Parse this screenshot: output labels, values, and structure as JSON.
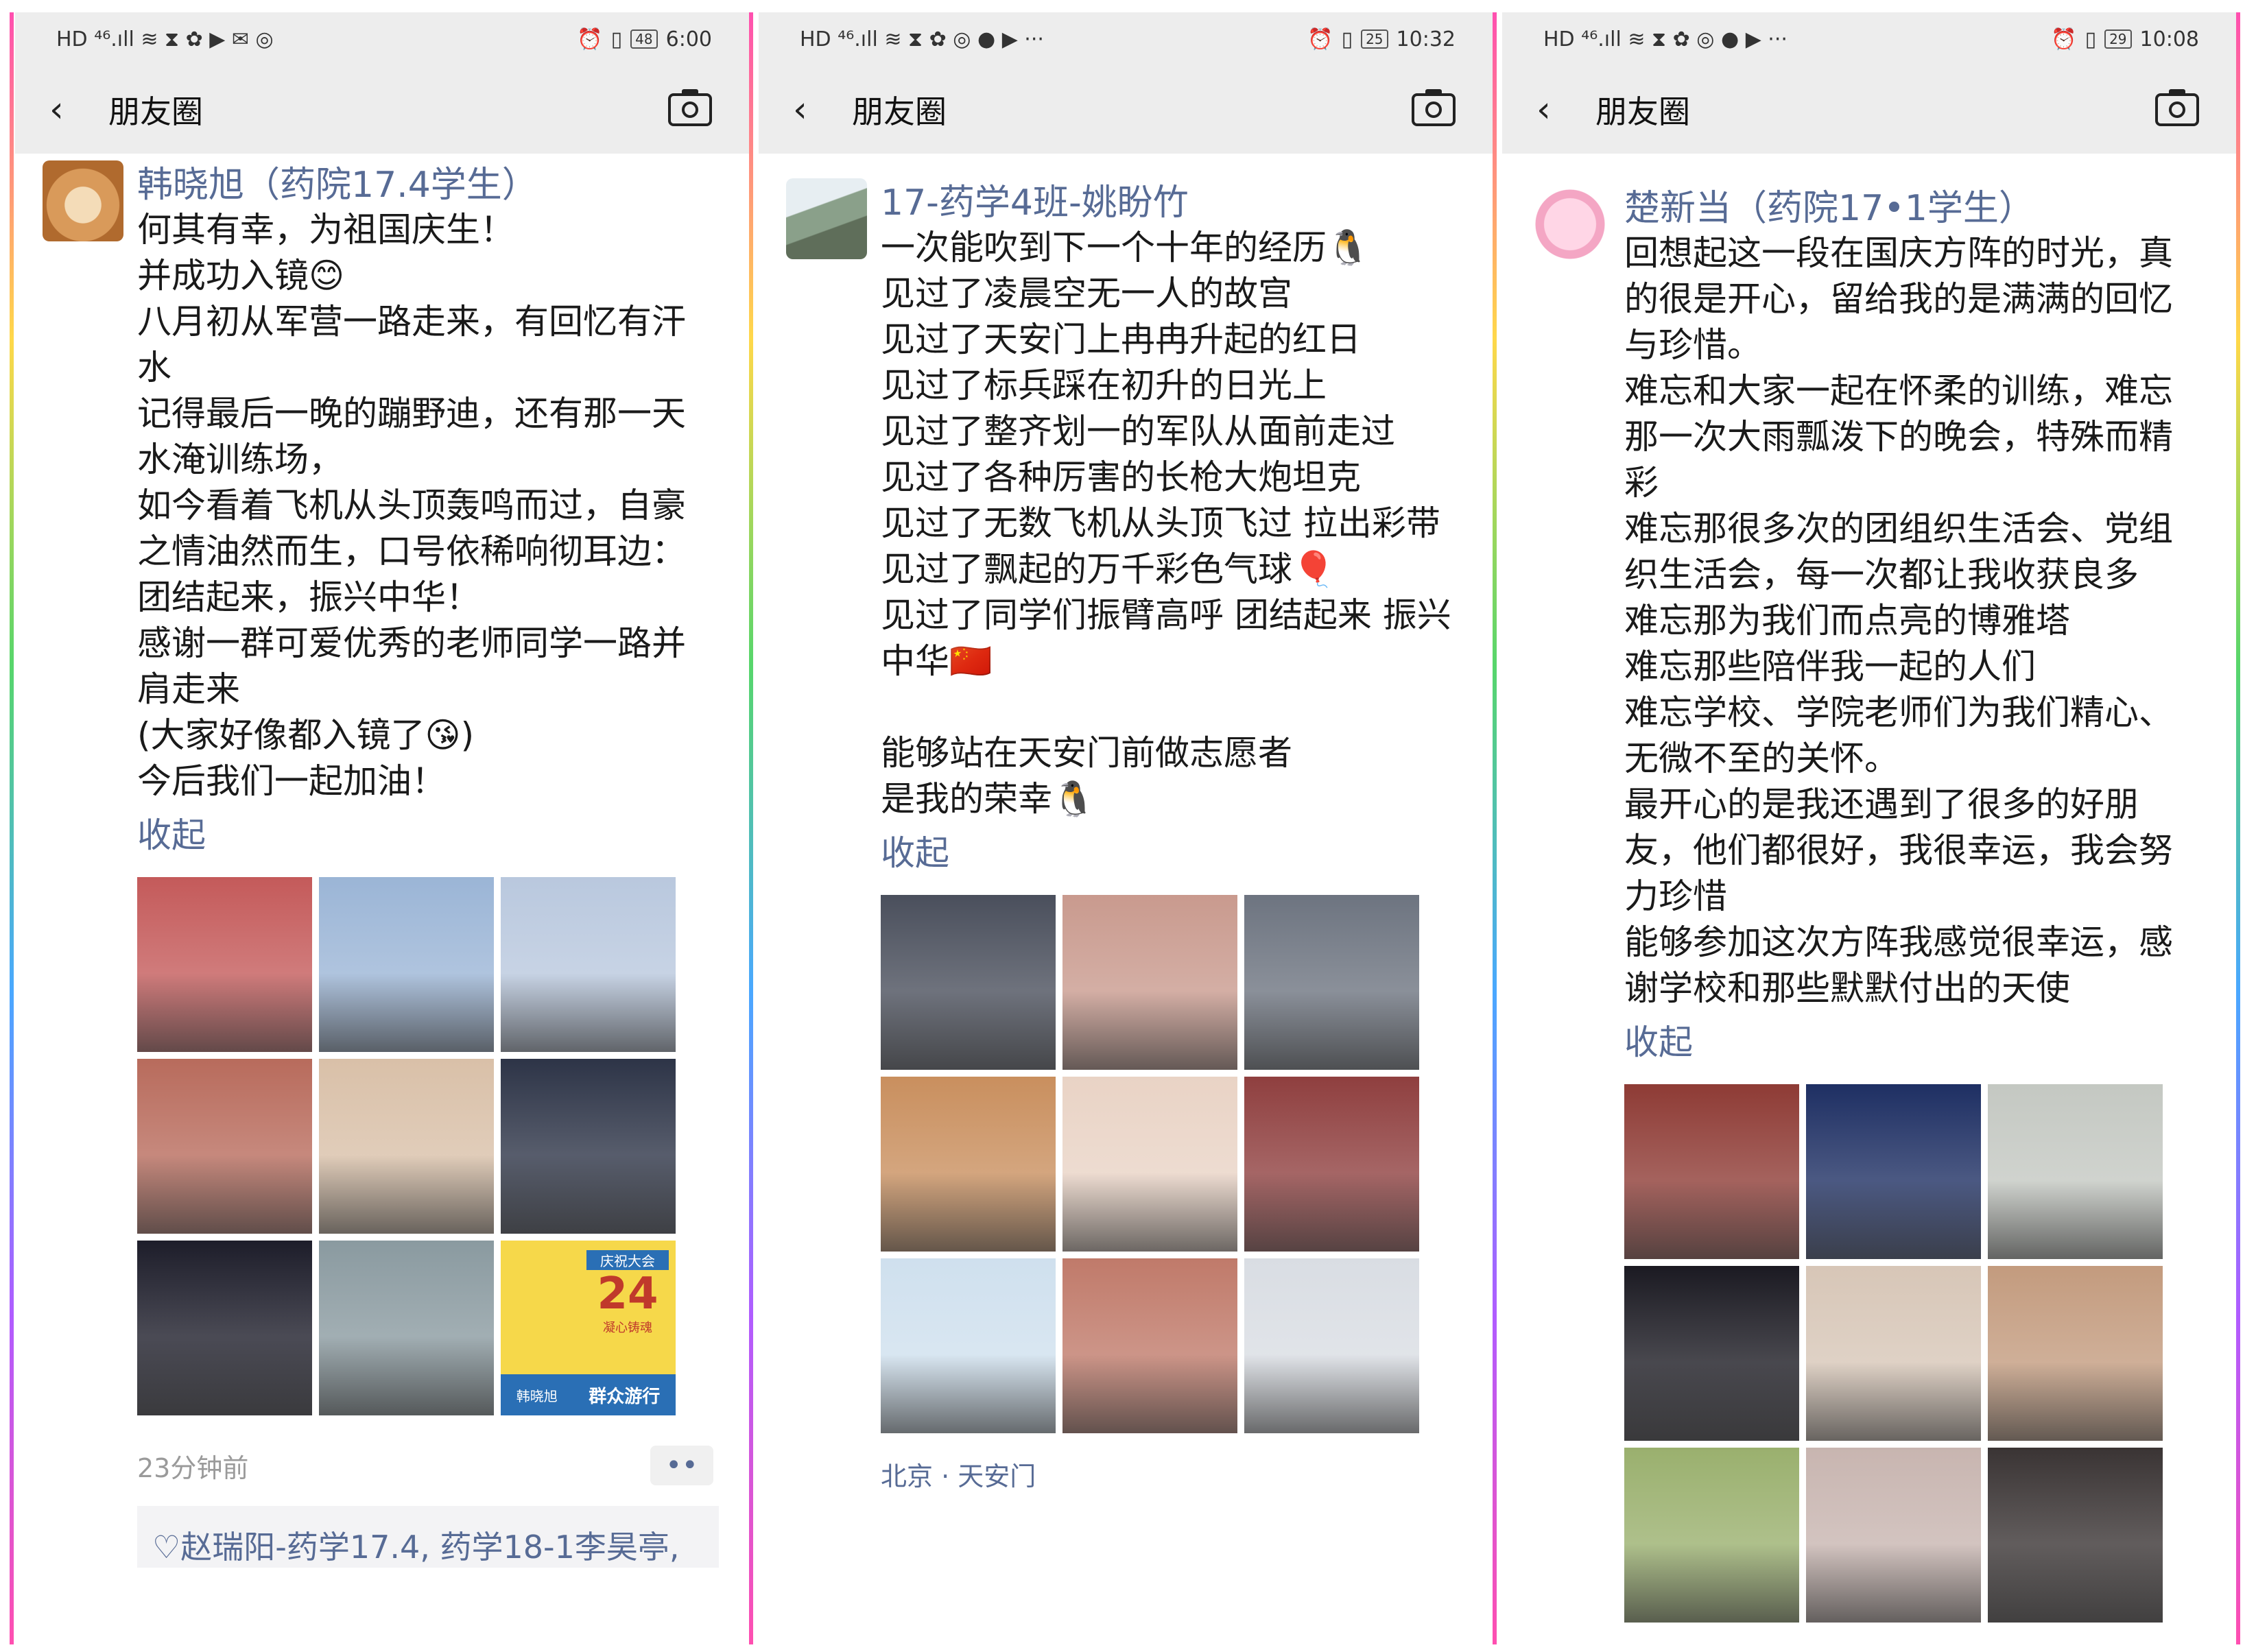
{
  "screens": [
    {
      "status": {
        "left_icons": "HD ⁴⁶.ıll ≋ ⧗ ✿ ▶ ✉ ◎",
        "battery": "48",
        "time": "6:00"
      },
      "nav": {
        "title": "朋友圈"
      },
      "post": {
        "author": "韩晓旭（药院17.4学生）",
        "text": "何其有幸，为祖国庆生！\n并成功入镜😊\n八月初从军营一路走来，有回忆有汗水\n记得最后一晚的蹦野迪，还有那一天水淹训练场，\n如今看着飞机从头顶轰鸣而过，自豪之情油然而生，口号依稀响彻耳边：团结起来，振兴中华！\n感谢一群可爱优秀的老师同学一路并肩走来\n(大家好像都入镜了😘)\n今后我们一起加油！",
        "collapse": "收起",
        "photo_colors": [
          "#c45a5a",
          "#9bb5d6",
          "#b9c8de",
          "#b86b5c",
          "#d9c0a8",
          "#2d3447",
          "#1d1d2a",
          "#8a9aa0",
          "#f3d14a"
        ],
        "photo_badge": {
          "title": "庆祝大会",
          "number": "24",
          "subtitle": "凝心铸魂",
          "name": "韩晓旭",
          "event": "群众游行"
        },
        "time": "23分钟前",
        "likes": "♡赵瑞阳-药学17.4, 药学18-1李昊亭,"
      }
    },
    {
      "status": {
        "left_icons": "HD ⁴⁶.ıll ≋ ⧗ ✿ ◎ ● ▶ ···",
        "battery": "25",
        "time": "10:32"
      },
      "nav": {
        "title": "朋友圈"
      },
      "post": {
        "author": "17-药学4班-姚盼竹",
        "text": "一次能吹到下一个十年的经历🐧\n见过了凌晨空无一人的故宫\n见过了天安门上冉冉升起的红日\n见过了标兵踩在初升的日光上\n见过了整齐划一的军队从面前走过\n见过了各种厉害的长枪大炮坦克\n见过了无数飞机从头顶飞过 拉出彩带\n见过了飘起的万千彩色气球🎈\n见过了同学们振臂高呼 团结起来 振兴中华🇨🇳\n\n能够站在天安门前做志愿者\n是我的荣幸🐧",
        "collapse": "收起",
        "photo_colors": [
          "#4a4f5c",
          "#c99a8e",
          "#6d7480",
          "#c98f5e",
          "#e9d3c5",
          "#8f3f3f",
          "#cfe0ee",
          "#c07a6a",
          "#d9dde3"
        ],
        "location": "北京 · 天安门"
      }
    },
    {
      "status": {
        "left_icons": "HD ⁴⁶.ıll ≋ ⧗ ✿ ◎ ● ▶ ···",
        "battery": "29",
        "time": "10:08"
      },
      "nav": {
        "title": "朋友圈"
      },
      "post": {
        "author": "楚新当（药院17•1学生）",
        "text": "回想起这一段在国庆方阵的时光，真的很是开心，留给我的是满满的回忆与珍惜。\n难忘和大家一起在怀柔的训练，难忘那一次大雨瓢泼下的晚会，特殊而精彩\n难忘那很多次的团组织生活会、党组织生活会，每一次都让我收获良多\n难忘那为我们而点亮的博雅塔\n难忘那些陪伴我一起的人们\n难忘学校、学院老师们为我们精心、无微不至的关怀。\n最开心的是我还遇到了很多的好朋友，他们都很好，我很幸运，我会努力珍惜\n能够参加这次方阵我感觉很幸运，感谢学校和那些默默付出的天使",
        "collapse": "收起",
        "photo_colors": [
          "#8e3b35",
          "#1e2f63",
          "#c4c8c2",
          "#1b1a22",
          "#d7c6b7",
          "#c39b7e",
          "#9ab06e",
          "#c8b5b0",
          "#3a3434"
        ]
      }
    }
  ]
}
